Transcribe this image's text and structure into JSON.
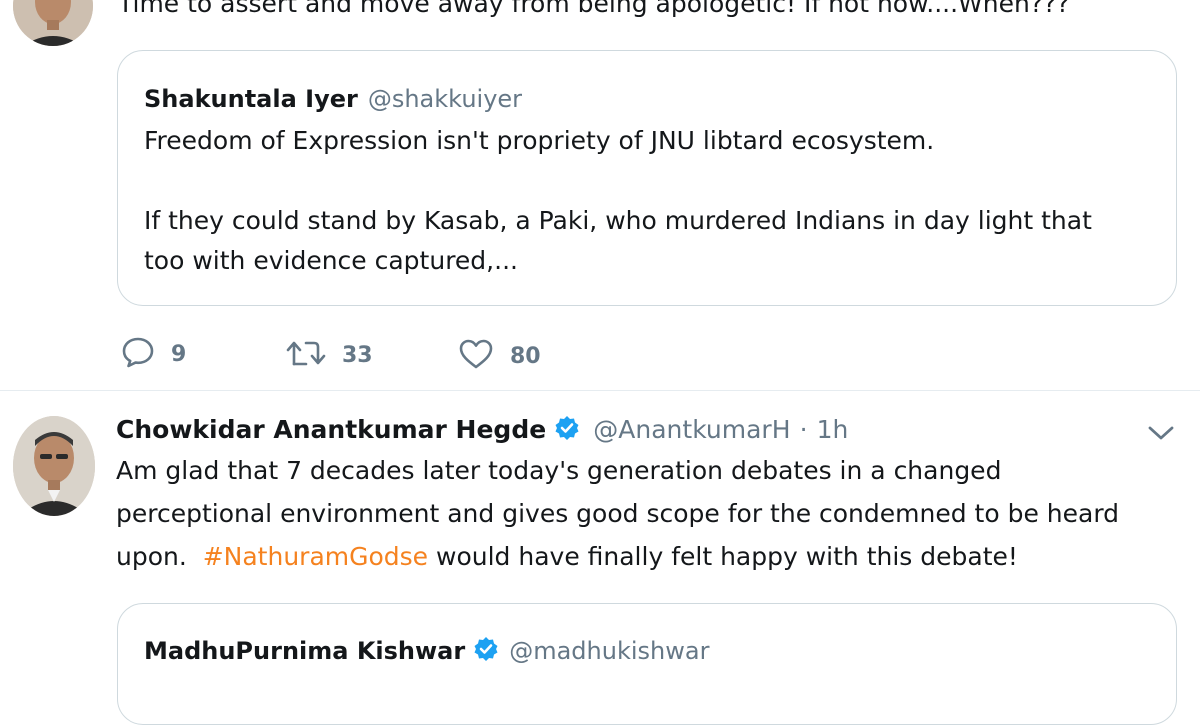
{
  "tweet1": {
    "partial_text": "Time to assert and move away from being apologetic!  If not now....When???",
    "quote": {
      "name": "Shakuntala Iyer",
      "handle": "@shakkuiyer",
      "line1": "Freedom of Expression isn't propriety of JNU libtard ecosystem.",
      "line2": "If they could stand by Kasab, a Paki, who murdered Indians in day light that",
      "line3": "too with evidence captured,..."
    },
    "actions": {
      "reply_count": "9",
      "retweet_count": "33",
      "like_count": "80"
    }
  },
  "tweet2": {
    "name": "Chowkidar Anantkumar Hegde",
    "handle": "@AnantkumarH",
    "separator": "·",
    "time": "1h",
    "line1": "Am glad that 7 decades later today's generation debates in a changed",
    "line2": "perceptional environment and gives good scope for the  condemned to be heard",
    "line3_prefix": "upon.  ",
    "hashtag": "#NathuramGodse",
    "line3_suffix": " would have finally felt happy with this debate!",
    "quote": {
      "name": "MadhuPurnima Kishwar",
      "handle": "@madhukishwar"
    }
  },
  "icons": {
    "reply": "reply-icon",
    "retweet": "retweet-icon",
    "like": "heart-icon",
    "verified": "verified-badge-icon",
    "more": "chevron-down-icon"
  },
  "colors": {
    "hashtag": "#f5821f",
    "verified": "#1da1f2",
    "secondary_text": "#657786",
    "border": "#cfd9de"
  }
}
